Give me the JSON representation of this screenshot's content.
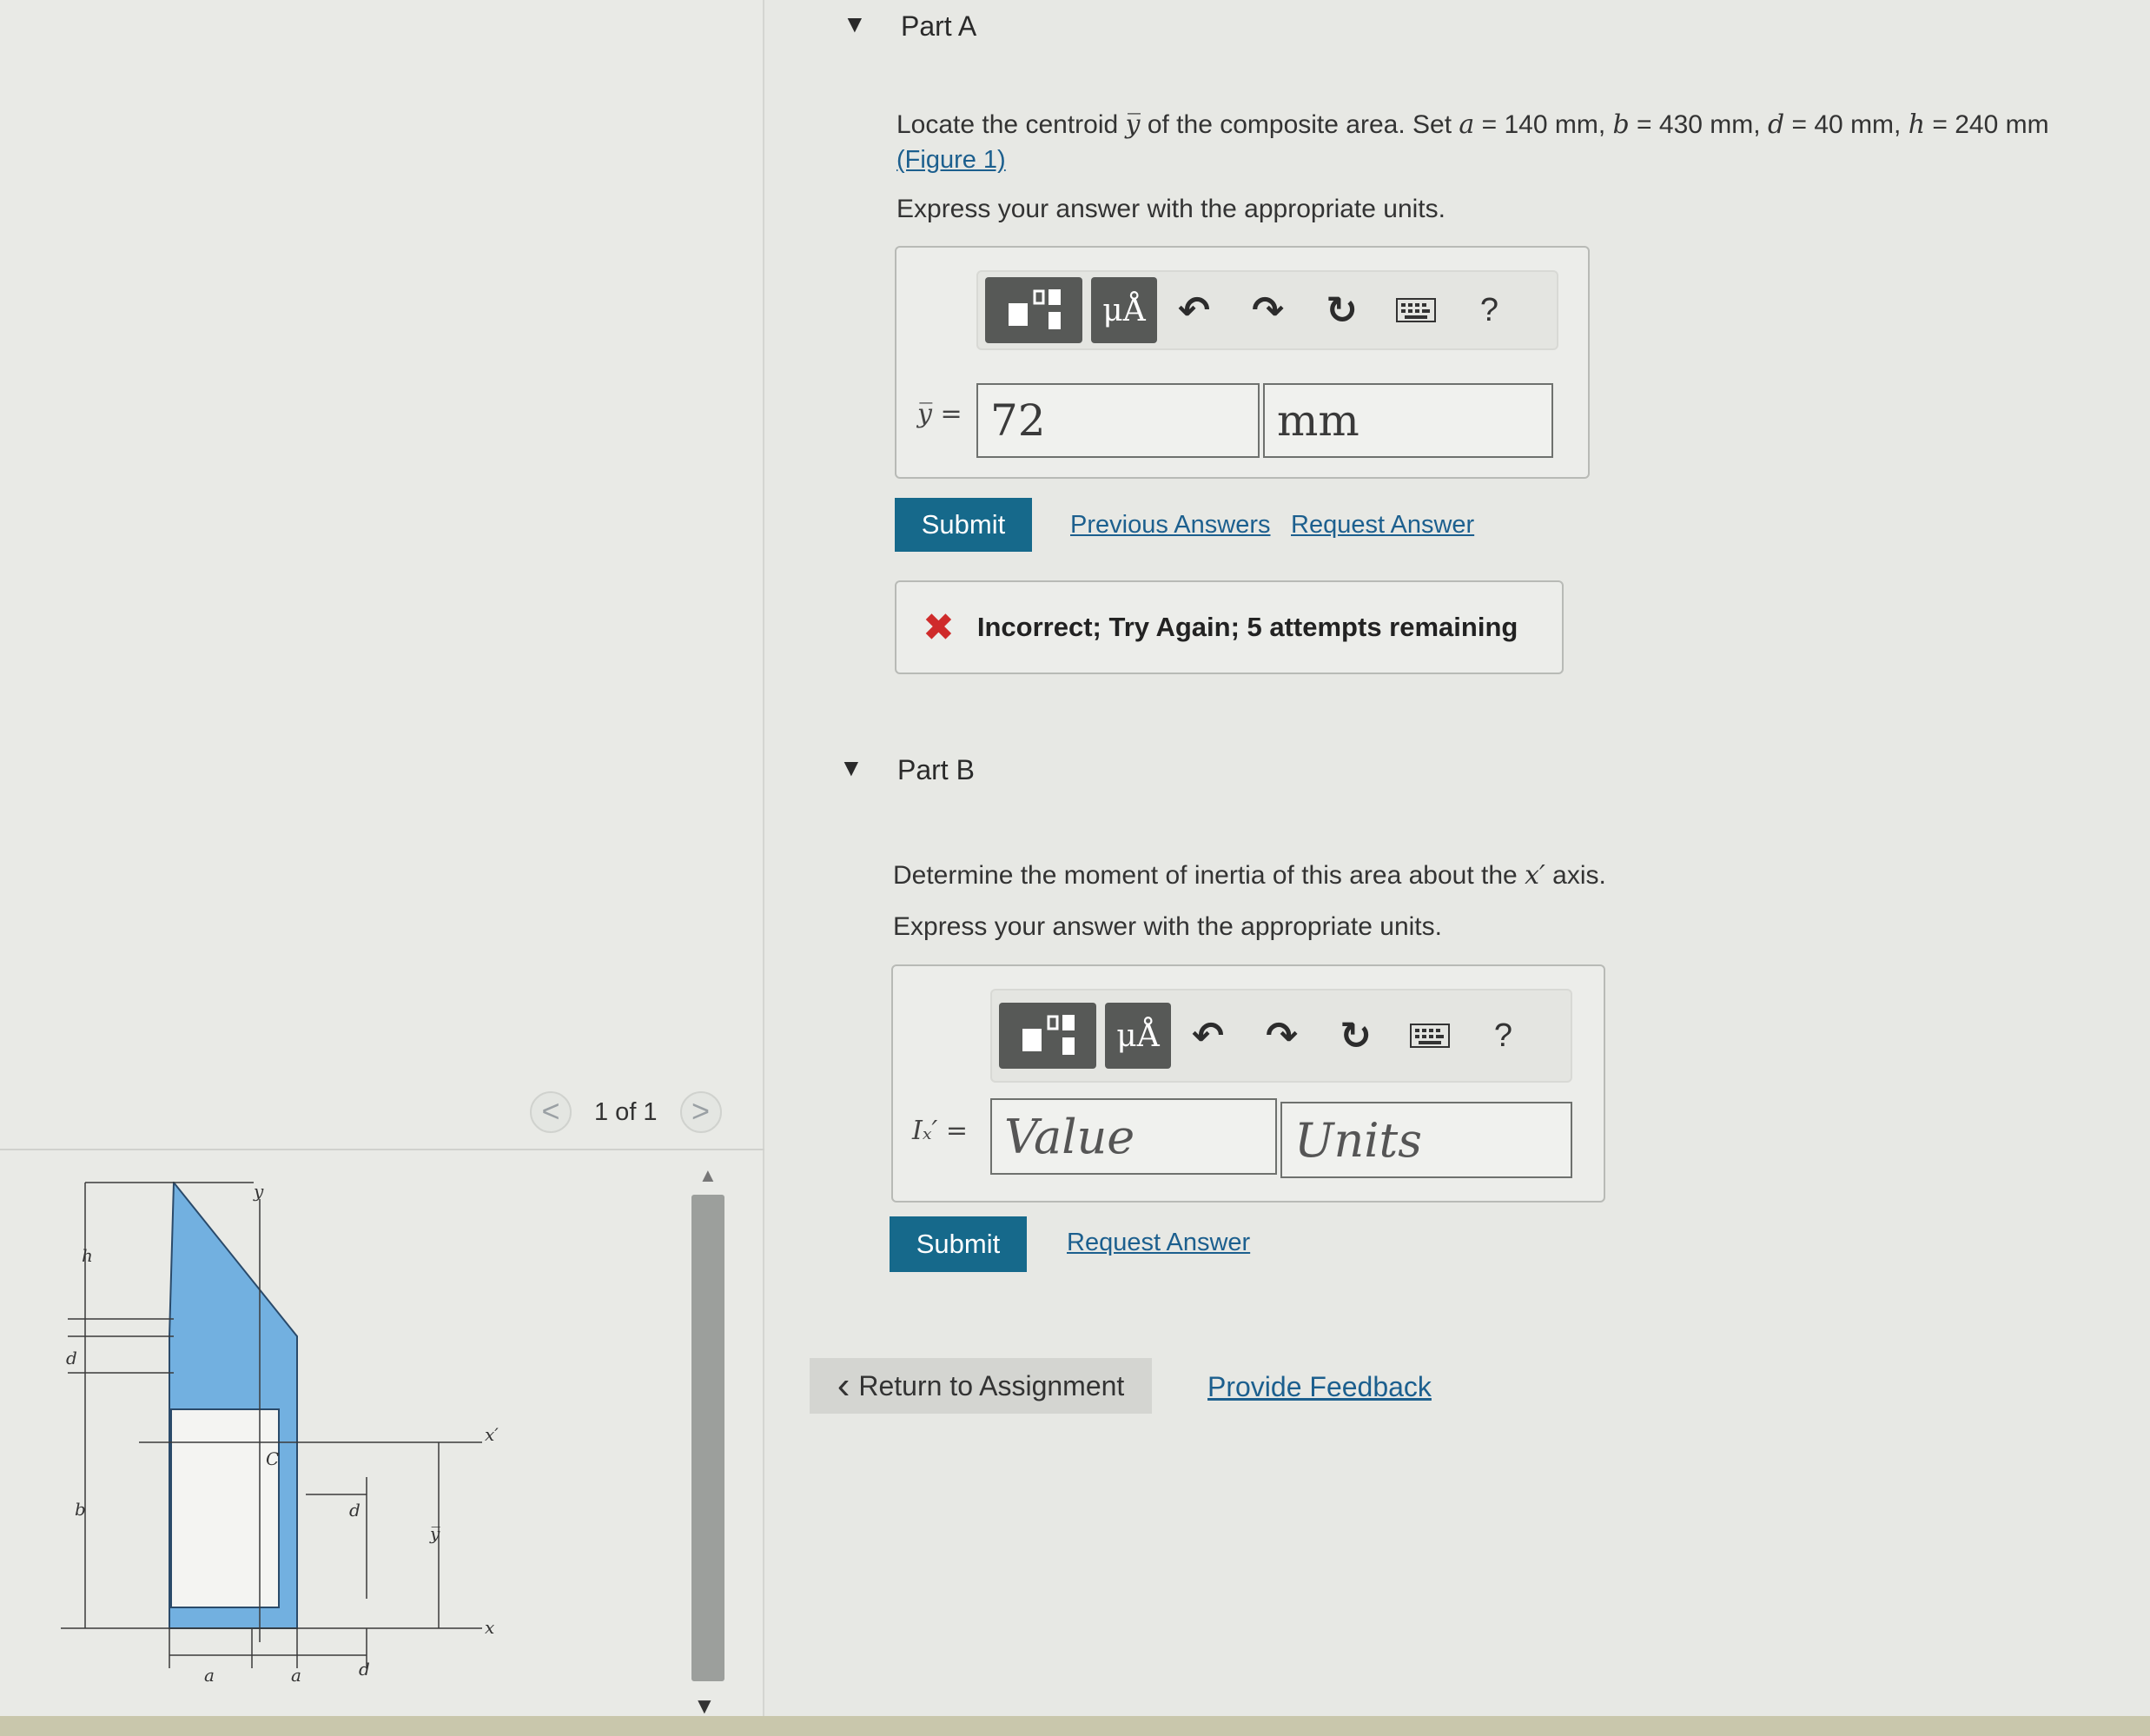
{
  "navigation": {
    "pager": {
      "prev_glyph": "<",
      "text": "1 of 1",
      "next_glyph": ">"
    }
  },
  "figure": {
    "labels": {
      "y_axis": "y",
      "x_axis": "x",
      "x_prime": "x′",
      "centroid": "C",
      "ybar": "y̅",
      "h": "h",
      "d": "d",
      "b": "b",
      "a": "a"
    },
    "colors": {
      "fill": "#72b0e0",
      "stroke": "#2a4a6a",
      "hole": "#f4f4f2"
    }
  },
  "partA": {
    "title": "Part A",
    "question_pre": "Locate the centroid",
    "question_mid": "of the composite area. Set",
    "params": [
      {
        "sym": "a",
        "text": " = 140 mm"
      },
      {
        "sym": "b",
        "text": " = 430 mm"
      },
      {
        "sym": "d",
        "text": " = 40 mm"
      },
      {
        "sym": "h",
        "text": " = 240 mm"
      }
    ],
    "figure_link": "(Figure 1)",
    "instruction": "Express your answer with the appropriate units.",
    "toolbar": {
      "mu_label": "μÅ",
      "undo": "↶",
      "redo": "↷",
      "reset": "↻",
      "help": "?"
    },
    "eq_label": "y̅ =",
    "value": "72",
    "units": "mm",
    "submit": "Submit",
    "prev_answers": "Previous Answers",
    "request_answer": "Request Answer",
    "feedback_icon": "✖",
    "feedback": "Incorrect; Try Again; 5 attempts remaining"
  },
  "partB": {
    "title": "Part B",
    "question_pre": "Determine the moment of inertia of this area about the",
    "question_post": "axis.",
    "instruction": "Express your answer with the appropriate units.",
    "toolbar": {
      "mu_label": "μÅ",
      "undo": "↶",
      "redo": "↷",
      "reset": "↻",
      "help": "?"
    },
    "eq_label": "Iₓ′ =",
    "value_placeholder": "Value",
    "units_placeholder": "Units",
    "submit": "Submit",
    "request_answer": "Request Answer"
  },
  "footer": {
    "return": "Return to Assignment",
    "return_icon": "‹",
    "feedback": "Provide Feedback"
  },
  "colors": {
    "primary": "#16698b",
    "link": "#1c5f8e",
    "error": "#cf2b2b"
  }
}
